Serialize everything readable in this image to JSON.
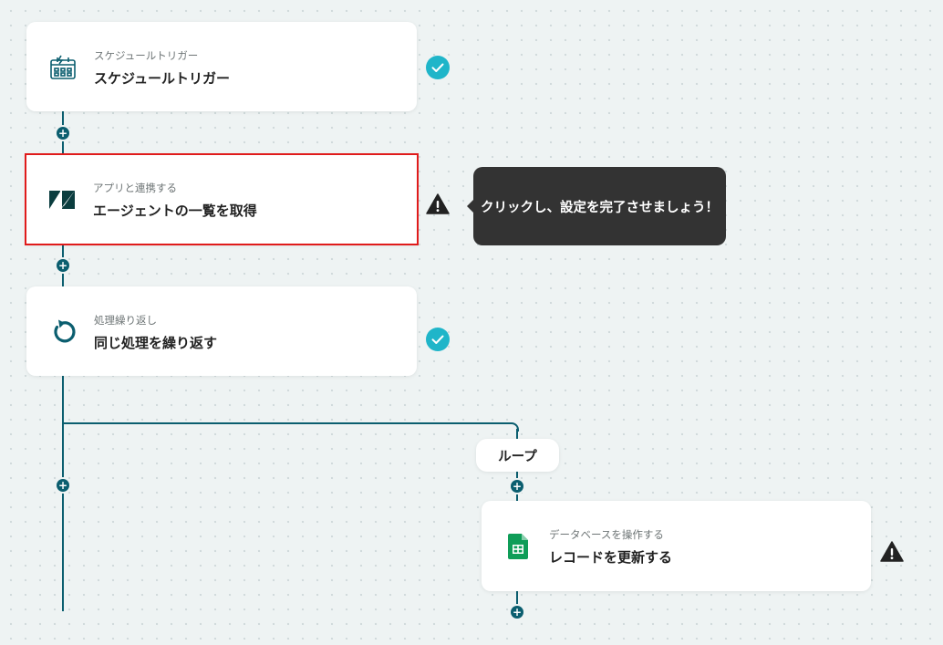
{
  "flow": {
    "steps": [
      {
        "subtitle": "スケジュールトリガー",
        "title": "スケジュールトリガー",
        "icon": "schedule-trigger-icon",
        "status": "complete"
      },
      {
        "subtitle": "アプリと連携する",
        "title": "エージェントの一覧を取得",
        "icon": "zendesk-icon",
        "status": "warning"
      },
      {
        "subtitle": "処理繰り返し",
        "title": "同じ処理を繰り返す",
        "icon": "loop-icon",
        "status": "complete"
      },
      {
        "subtitle": "データベースを操作する",
        "title": "レコードを更新する",
        "icon": "google-sheets-icon",
        "status": "warning"
      }
    ],
    "tooltip": "クリックし、設定を完了させましょう！",
    "loop_label": "ループ"
  },
  "colors": {
    "connector": "#0b5e6f",
    "complete": "#1fb5c9",
    "warning": "#222222",
    "selected_border": "#e01b1b",
    "tooltip_bg": "#333333",
    "sheets_green": "#0f9d58"
  }
}
